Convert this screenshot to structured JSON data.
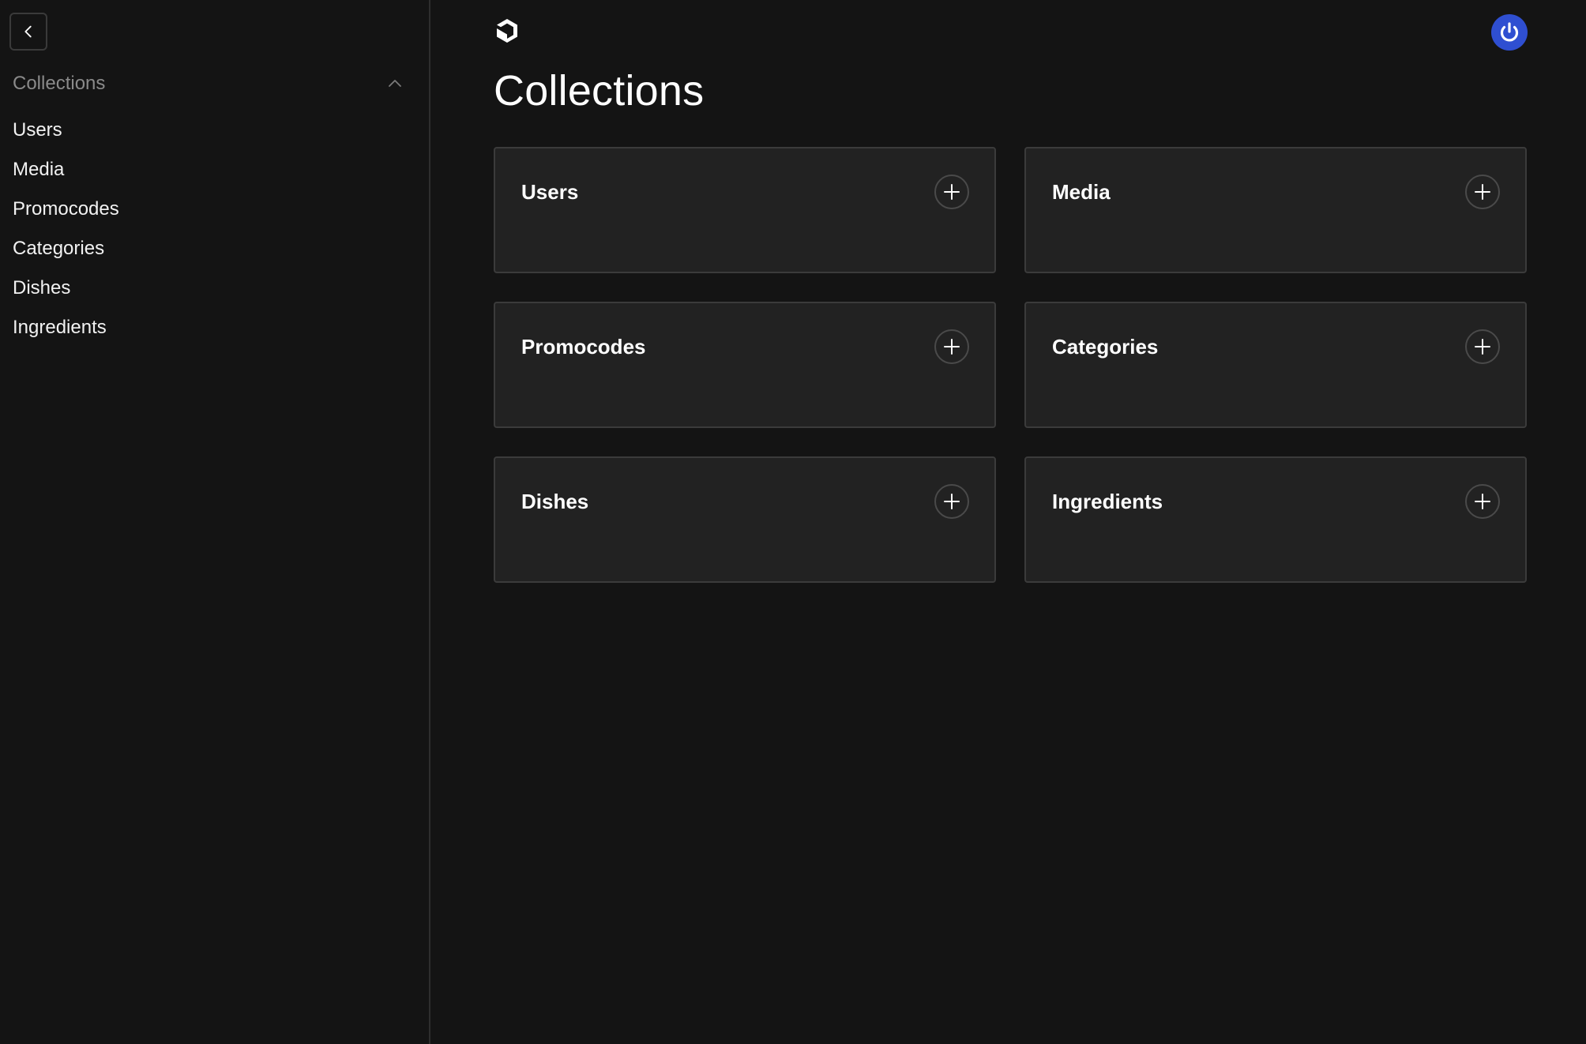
{
  "sidebar": {
    "collapse_icon": "chevron-left-icon",
    "group": {
      "title": "Collections",
      "toggle_icon": "chevron-up-icon"
    },
    "items": [
      {
        "label": "Users"
      },
      {
        "label": "Media"
      },
      {
        "label": "Promocodes"
      },
      {
        "label": "Categories"
      },
      {
        "label": "Dishes"
      },
      {
        "label": "Ingredients"
      }
    ]
  },
  "header": {
    "logo_icon": "payload-logo-icon",
    "account_icon": "power-icon",
    "account_color": "#2f4fd1"
  },
  "main": {
    "title": "Collections",
    "cards": [
      {
        "title": "Users",
        "action_icon": "plus-icon"
      },
      {
        "title": "Media",
        "action_icon": "plus-icon"
      },
      {
        "title": "Promocodes",
        "action_icon": "plus-icon"
      },
      {
        "title": "Categories",
        "action_icon": "plus-icon"
      },
      {
        "title": "Dishes",
        "action_icon": "plus-icon"
      },
      {
        "title": "Ingredients",
        "action_icon": "plus-icon"
      }
    ]
  },
  "colors": {
    "background": "#141414",
    "card_background": "#222222",
    "card_border": "#3b3b3b",
    "muted_text": "#8a8a8a"
  }
}
